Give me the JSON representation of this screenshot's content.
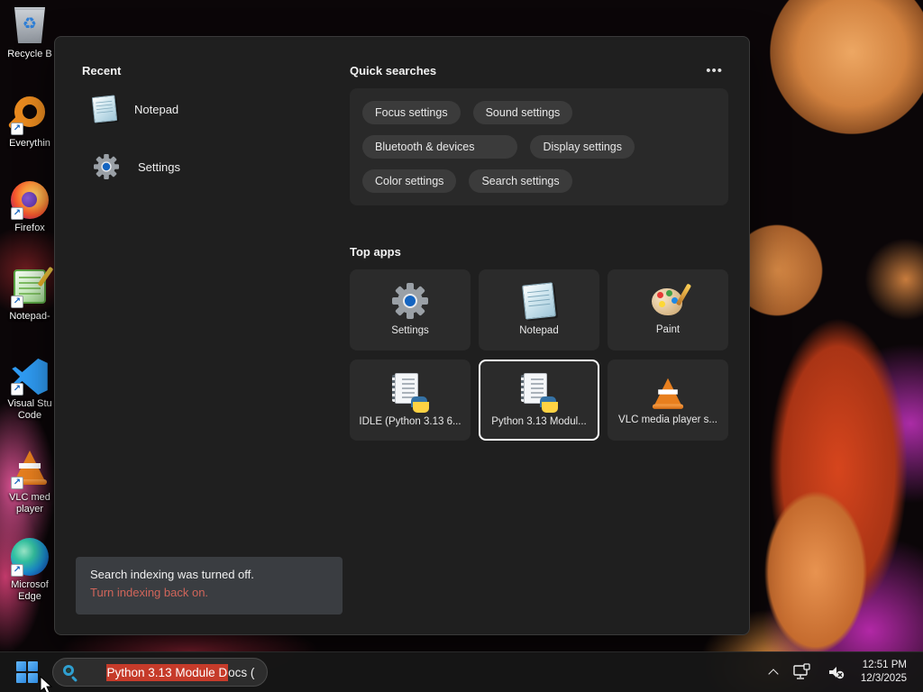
{
  "desktop": {
    "icons": [
      {
        "label": "Recycle B"
      },
      {
        "label": "Everythin"
      },
      {
        "label": "Firefox"
      },
      {
        "label": "Notepad-"
      },
      {
        "label": "Visual Stu\nCode"
      },
      {
        "label": "VLC med\nplayer"
      },
      {
        "label": "Microsof\nEdge"
      }
    ]
  },
  "search_panel": {
    "recent": {
      "header": "Recent",
      "items": [
        {
          "label": "Notepad"
        },
        {
          "label": "Settings"
        }
      ]
    },
    "quick_searches": {
      "header": "Quick searches",
      "more_label": "•••",
      "pills": [
        "Focus settings",
        "Sound settings",
        "Bluetooth & devices",
        "Display settings",
        "Color settings",
        "Search settings"
      ]
    },
    "top_apps": {
      "header": "Top apps",
      "tiles": [
        {
          "label": "Settings"
        },
        {
          "label": "Notepad"
        },
        {
          "label": "Paint"
        },
        {
          "label": "IDLE (Python 3.13 6..."
        },
        {
          "label": "Python 3.13 Modul...",
          "selected": true
        },
        {
          "label": "VLC media player s..."
        }
      ]
    },
    "notification": {
      "line1": "Search indexing was turned off.",
      "line2": "Turn indexing back on.",
      "link_color": "#d0655a"
    }
  },
  "taskbar": {
    "search": {
      "highlighted_text": "Python 3.13 Module D",
      "rest_text": "ocs (",
      "highlight_color": "#c63b2a"
    },
    "tray": {
      "time": "12:51 PM",
      "date": "12/3/2025"
    }
  }
}
